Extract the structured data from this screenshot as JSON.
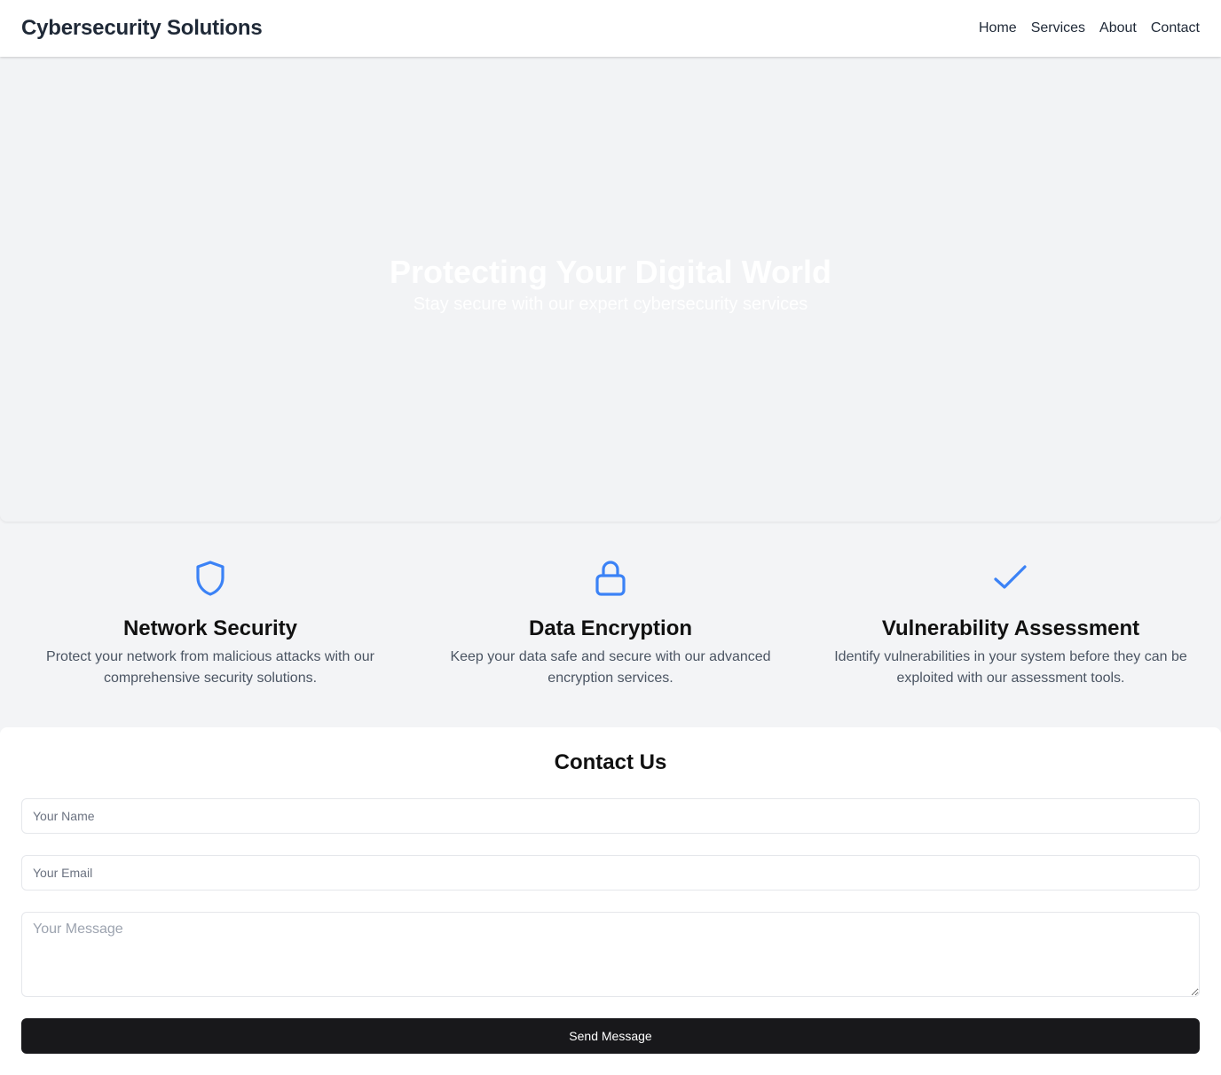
{
  "header": {
    "brand": "Cybersecurity Solutions",
    "nav": [
      {
        "label": "Home"
      },
      {
        "label": "Services"
      },
      {
        "label": "About"
      },
      {
        "label": "Contact"
      }
    ]
  },
  "hero": {
    "title": "Protecting Your Digital World",
    "subtitle": "Stay secure with our expert cybersecurity services"
  },
  "services": [
    {
      "icon": "shield-icon",
      "title": "Network Security",
      "description": "Protect your network from malicious attacks with our comprehensive security solutions."
    },
    {
      "icon": "lock-icon",
      "title": "Data Encryption",
      "description": "Keep your data safe and secure with our advanced encryption services."
    },
    {
      "icon": "check-icon",
      "title": "Vulnerability Assessment",
      "description": "Identify vulnerabilities in your system before they can be exploited with our assessment tools."
    }
  ],
  "contact": {
    "title": "Contact Us",
    "name_placeholder": "Your Name",
    "email_placeholder": "Your Email",
    "message_placeholder": "Your Message",
    "submit_label": "Send Message"
  },
  "colors": {
    "accent": "#3b82f6",
    "button": "#18181b"
  }
}
